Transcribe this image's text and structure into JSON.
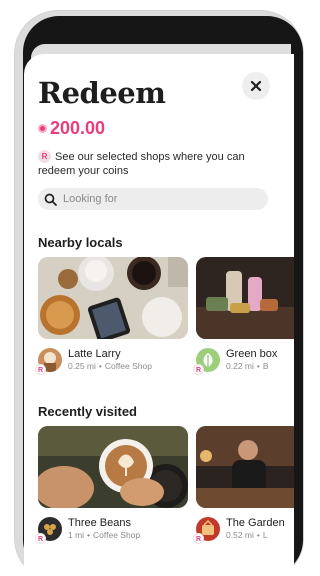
{
  "page": {
    "title": "Redeem"
  },
  "balance": {
    "amount": "200.00"
  },
  "info": {
    "badge": "R",
    "text": "See our selected shops where you can redeem your coins"
  },
  "search": {
    "placeholder": "Looking for"
  },
  "sections": {
    "nearby": {
      "title": "Nearby locals",
      "shops": [
        {
          "name": "Latte Larry",
          "distance": "0.25 mi",
          "category": "Coffee Shop"
        },
        {
          "name": "Green box",
          "distance": "0.22 mi",
          "category": "B"
        }
      ]
    },
    "recent": {
      "title": "Recently visited",
      "shops": [
        {
          "name": "Three Beans",
          "distance": "1 mi",
          "category": "Coffee Shop"
        },
        {
          "name": "The Garden",
          "distance": "0.52 mi",
          "category": "L"
        }
      ]
    }
  },
  "badge_letter": "R",
  "separator": "•",
  "colors": {
    "accent": "#e93d7c",
    "search_bg": "#ededed",
    "frame": "#dcdcdc"
  },
  "icons": {
    "close": "close-icon",
    "search": "search-icon",
    "coin": "coin-icon"
  }
}
